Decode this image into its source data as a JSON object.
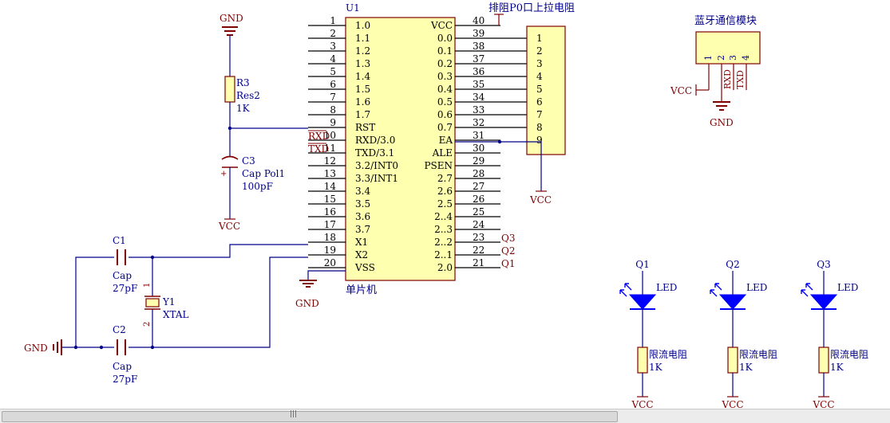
{
  "colors": {
    "background": "#ffffff",
    "wire": "#00008c",
    "component": "#800000",
    "body_fill": "#ffffb0",
    "label": "#00008c",
    "power": "#800000",
    "led": "#0000ff"
  },
  "mcu": {
    "designator": "U1",
    "name": "单片机",
    "left_pins": [
      {
        "num": "1",
        "label": "1.0"
      },
      {
        "num": "2",
        "label": "1.1"
      },
      {
        "num": "3",
        "label": "1.2"
      },
      {
        "num": "4",
        "label": "1.3"
      },
      {
        "num": "5",
        "label": "1.4"
      },
      {
        "num": "6",
        "label": "1.5"
      },
      {
        "num": "7",
        "label": "1.6"
      },
      {
        "num": "8",
        "label": "1.7"
      },
      {
        "num": "9",
        "label": "RST"
      },
      {
        "num": "10",
        "label": "RXD/3.0"
      },
      {
        "num": "11",
        "label": "TXD/3.1"
      },
      {
        "num": "12",
        "label": "3.2/INT0"
      },
      {
        "num": "13",
        "label": "3.3/INT1"
      },
      {
        "num": "14",
        "label": "3.4"
      },
      {
        "num": "15",
        "label": "3.5"
      },
      {
        "num": "16",
        "label": "3.6"
      },
      {
        "num": "17",
        "label": "3.7"
      },
      {
        "num": "18",
        "label": "X1"
      },
      {
        "num": "19",
        "label": "X2"
      },
      {
        "num": "20",
        "label": "VSS"
      }
    ],
    "right_pins": [
      {
        "num": "40",
        "label": "VCC"
      },
      {
        "num": "39",
        "label": "0.0"
      },
      {
        "num": "38",
        "label": "0.1"
      },
      {
        "num": "37",
        "label": "0.2"
      },
      {
        "num": "36",
        "label": "0.3"
      },
      {
        "num": "35",
        "label": "0.4"
      },
      {
        "num": "34",
        "label": "0.5"
      },
      {
        "num": "33",
        "label": "0.6"
      },
      {
        "num": "32",
        "label": "0.7"
      },
      {
        "num": "31",
        "label": "EA"
      },
      {
        "num": "30",
        "label": "ALE"
      },
      {
        "num": "29",
        "label": "PSEN"
      },
      {
        "num": "28",
        "label": "2.7"
      },
      {
        "num": "27",
        "label": "2.6"
      },
      {
        "num": "26",
        "label": "2.5"
      },
      {
        "num": "25",
        "label": "2..4"
      },
      {
        "num": "24",
        "label": "2..3"
      },
      {
        "num": "23",
        "label": "2..2"
      },
      {
        "num": "22",
        "label": "2..1"
      },
      {
        "num": "21",
        "label": "2.0"
      }
    ]
  },
  "net_labels": {
    "rxd": "RXD",
    "txd": "TXD",
    "q3": "Q3",
    "q2": "Q2",
    "q1": "Q1"
  },
  "resistor_pack": {
    "title": "排阻P0口上拉电阻",
    "pins": [
      "1",
      "2",
      "3",
      "4",
      "5",
      "6",
      "7",
      "8",
      "9"
    ],
    "vcc": "VCC"
  },
  "reset": {
    "gnd": "GND",
    "r_designator": "R3",
    "r_name": "Res2",
    "r_value": "1K",
    "c_designator": "C3",
    "c_name": "Cap Pol1",
    "c_value": "100pF",
    "c_plus": "+",
    "vcc": "VCC"
  },
  "crystal": {
    "c1_designator": "C1",
    "c1_name": "Cap",
    "c1_value": "27pF",
    "c2_designator": "C2",
    "c2_name": "Cap",
    "c2_value": "27pF",
    "y_designator": "Y1",
    "y_name": "XTAL",
    "pin1": "1",
    "pin2": "2",
    "gnd": "GND"
  },
  "mcu_gnd": "GND",
  "bluetooth": {
    "title": "蓝牙通信模块",
    "pins": [
      "1",
      "2",
      "3",
      "4"
    ],
    "rxd": "RXD",
    "txd": "TXD",
    "vcc": "VCC",
    "gnd": "GND"
  },
  "leds": [
    {
      "net": "Q1",
      "name": "LED",
      "res_name": "限流电阻",
      "res_value": "1K",
      "vcc": "VCC"
    },
    {
      "net": "Q2",
      "name": "LED",
      "res_name": "限流电阻",
      "res_value": "1K",
      "vcc": "VCC"
    },
    {
      "net": "Q3",
      "name": "LED",
      "res_name": "限流电阻",
      "res_value": "1K",
      "vcc": "VCC"
    }
  ],
  "scrollbar": {
    "grip": "|||"
  }
}
